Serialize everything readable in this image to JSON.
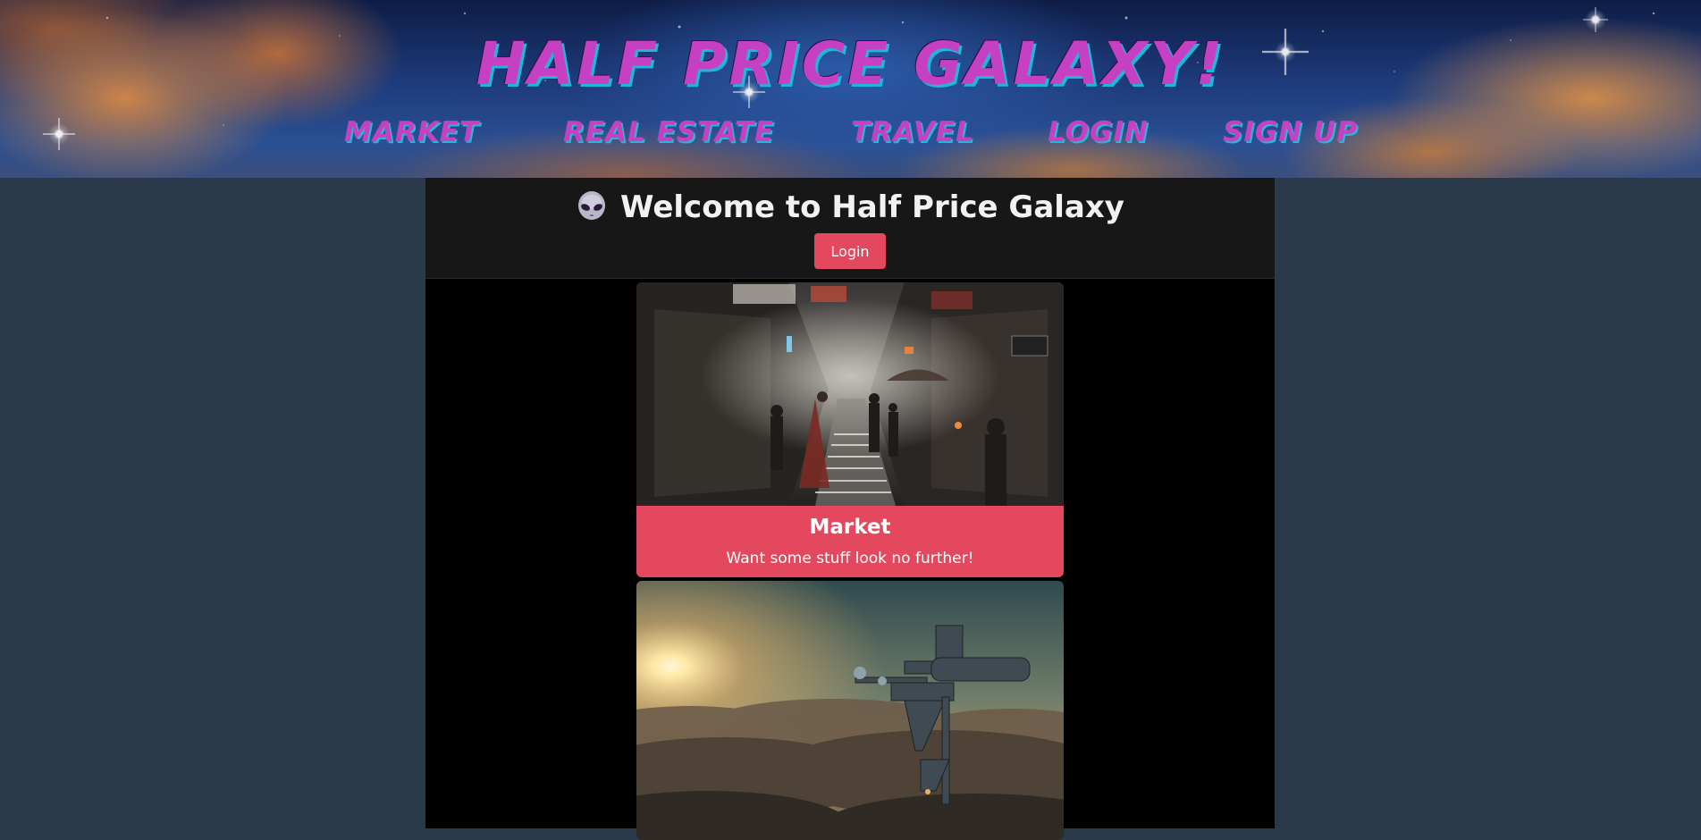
{
  "header": {
    "site_title": "Half Price Galaxy!",
    "nav": {
      "market": "Market",
      "real_estate": "Real Estate",
      "travel": "Travel",
      "login": "Login",
      "sign_up": "Sign Up"
    }
  },
  "welcome": {
    "icon": "alien-icon",
    "title": "Welcome to Half Price Galaxy",
    "login_label": "Login"
  },
  "cards": [
    {
      "image": "futuristic-market-street-image",
      "title": "Market",
      "text": "Want some stuff look no further!"
    },
    {
      "image": "sky-platform-above-clouds-image"
    }
  ],
  "colors": {
    "page_background": "#2b3a4b",
    "content_background": "#000000",
    "welcome_background": "#171717",
    "accent": "#e4485f",
    "title_magenta": "#c640c4",
    "title_cyan_shadow": "#1fb6d8"
  }
}
